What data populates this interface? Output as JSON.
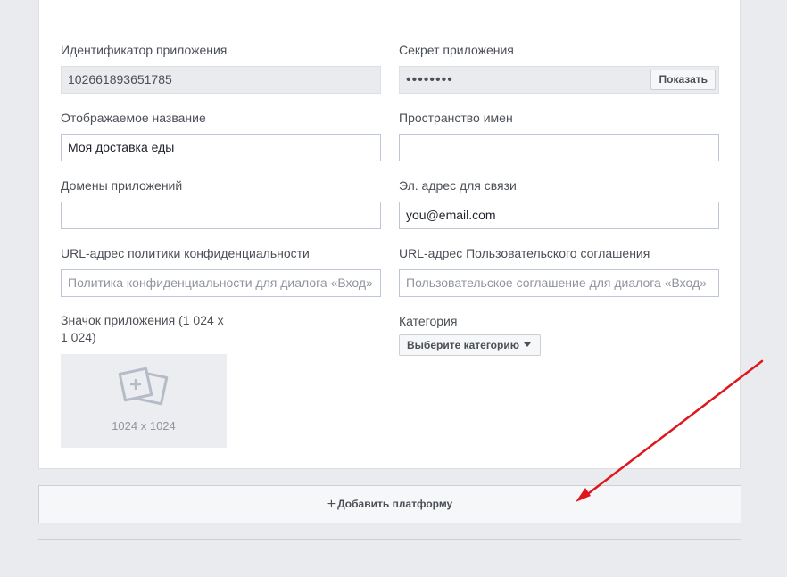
{
  "form": {
    "app_id": {
      "label": "Идентификатор приложения",
      "value": "102661893651785"
    },
    "app_secret": {
      "label": "Секрет приложения",
      "value": "••••••••",
      "show_label": "Показать"
    },
    "display_name": {
      "label": "Отображаемое название",
      "value": "Моя доставка еды"
    },
    "namespace": {
      "label": "Пространство имен",
      "value": ""
    },
    "app_domains": {
      "label": "Домены приложений",
      "value": ""
    },
    "contact_email": {
      "label": "Эл. адрес для связи",
      "value": "you@email.com"
    },
    "privacy_url": {
      "label": "URL-адрес политики конфиденциальности",
      "placeholder": "Политика конфиденциальности для диалога «Вход»"
    },
    "terms_url": {
      "label": "URL-адрес Пользовательского соглашения",
      "placeholder": "Пользовательское соглашение для диалога «Вход»"
    },
    "app_icon": {
      "label": "Значок приложения (1 024 x 1 024)",
      "size_text": "1024 x 1024",
      "icon": "image-add-icon"
    },
    "category": {
      "label": "Категория",
      "select_label": "Выберите категорию",
      "icon": "caret-down-icon"
    }
  },
  "add_platform": {
    "label": "Добавить платформу",
    "icon": "plus-icon"
  },
  "colors": {
    "background": "#e9ebee",
    "card": "#ffffff",
    "arrow": "#e0161c",
    "label": "#4b4f56"
  }
}
